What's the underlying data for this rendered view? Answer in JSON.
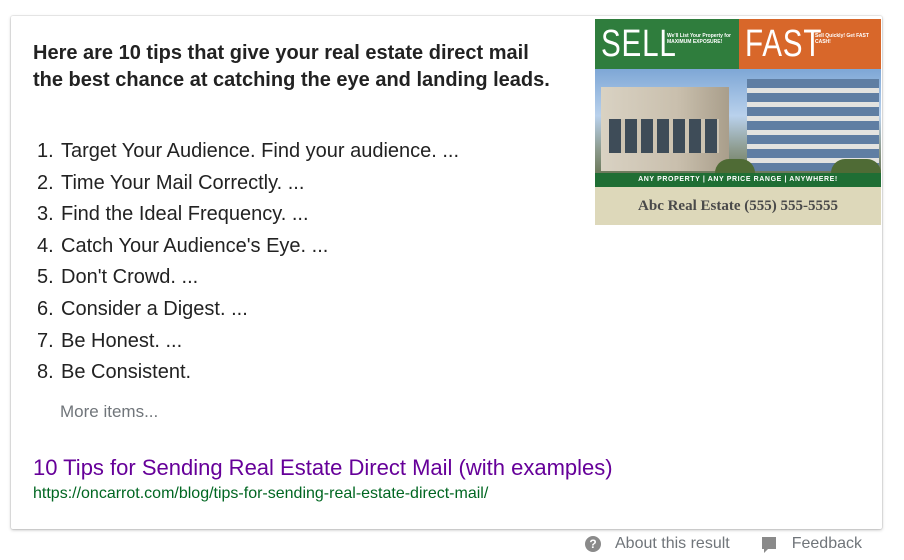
{
  "snippet": {
    "headline": "Here are 10 tips that give your real estate direct mail the best chance at catching the eye and landing leads.",
    "tips": [
      {
        "num": "1.",
        "text": "Target Your Audience. Find your audience. ..."
      },
      {
        "num": "2.",
        "text": "Time Your Mail Correctly. ..."
      },
      {
        "num": "3.",
        "text": "Find the Ideal Frequency. ..."
      },
      {
        "num": "4.",
        "text": "Catch Your Audience's Eye. ..."
      },
      {
        "num": "5.",
        "text": "Don't Crowd. ..."
      },
      {
        "num": "6.",
        "text": "Consider a Digest. ..."
      },
      {
        "num": "7.",
        "text": "Be Honest. ..."
      },
      {
        "num": "8.",
        "text": "Be Consistent."
      }
    ],
    "more_items": "More items...",
    "result_title": "10 Tips for Sending Real Estate Direct Mail (with examples)",
    "result_url": "https://oncarrot.com/blog/tips-for-sending-real-estate-direct-mail/"
  },
  "thumbnail": {
    "left_word": "SELL",
    "left_small": "We'll List Your Property for MAXIMUM EXPOSURE!",
    "right_word": "FAST",
    "right_small": "Sell Quickly! Get FAST CASH!",
    "strip": "ANY PROPERTY | ANY PRICE RANGE | ANYWHERE!",
    "bottom": "Abc Real Estate (555) 555-5555"
  },
  "footer": {
    "about": "About this result",
    "feedback": "Feedback"
  },
  "colors": {
    "visited_link": "#660099",
    "url_green": "#006621",
    "muted_text": "#70757a",
    "body_text": "#222222"
  },
  "icons": {
    "help": "question-circle-icon",
    "feedback": "speech-bubble-icon"
  }
}
